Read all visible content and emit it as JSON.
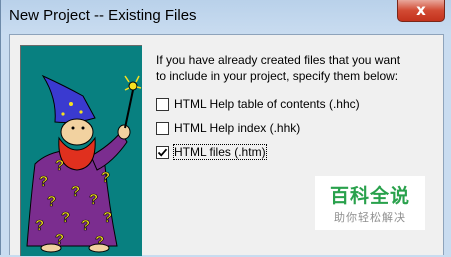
{
  "window": {
    "title": "New Project -- Existing Files",
    "close_glyph": "x"
  },
  "instructions": "If you have already created files that you want\nto include in your project, specify them below:",
  "options": [
    {
      "label": "HTML Help table of contents (.hhc)",
      "checked": false
    },
    {
      "label": "HTML Help index (.hhk)",
      "checked": false
    },
    {
      "label": "HTML files (.htm)",
      "checked": true
    }
  ],
  "watermark": {
    "main": "百科全说",
    "sub": "助你轻松解决"
  },
  "colors": {
    "art_background": "#088080",
    "wizard_robe": "#7b2d8f",
    "wizard_hat": "#3a3ad0",
    "watermark_green": "#29a14c"
  },
  "icons": {
    "close": "close-icon",
    "art": "wizard-illustration",
    "check": "checkmark-icon"
  }
}
